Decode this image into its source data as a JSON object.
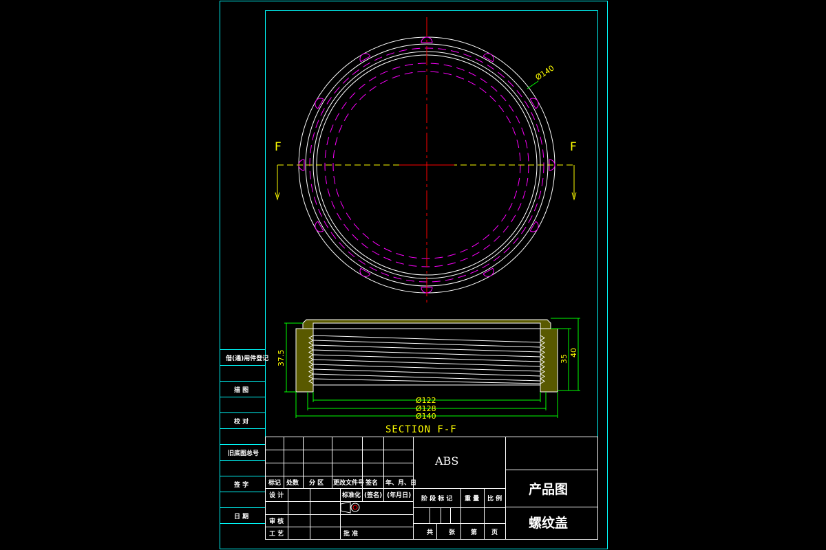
{
  "colors": {
    "frame": "#00ffff",
    "outline": "#ffffff",
    "hidden": "#ff00ff",
    "center": "#ff0000",
    "dimension": "#00ff00",
    "section_line": "#ffff00",
    "hatch": "#ffff00",
    "text_white": "#ffffff",
    "text_yellow": "#ffff00"
  },
  "top_view": {
    "section_marker_left": "F",
    "section_marker_right": "F",
    "dim_diameter": "Ø140"
  },
  "section_view": {
    "title": "SECTION F-F",
    "dim_inner": "Ø122",
    "dim_thread": "Ø128",
    "dim_outer": "Ø140",
    "dim_left_height": "37.5",
    "dim_right_inner_height": "35",
    "dim_right_outer_height": "40"
  },
  "side_column": {
    "items": [
      "借(通)用件登记",
      "描 图",
      "校 对",
      "旧底图总号",
      "签 字",
      "日 期"
    ]
  },
  "title_block": {
    "material": "ABS",
    "drawing_type": "产品图",
    "part_name": "螺纹盖",
    "rev_headers": [
      "标记",
      "处数",
      "分 区",
      "更改文件号",
      "签名",
      "年、月、日"
    ],
    "design_row": [
      "设 计",
      "标准化",
      "(签名)",
      "(年月日)"
    ],
    "review_label": "审 核",
    "process_label": "工 艺",
    "approve_label": "批 准",
    "stage_headers": [
      "阶 段 标 记",
      "重 量",
      "比 例"
    ],
    "sheet_info": [
      "共",
      "张",
      "第",
      "页"
    ]
  }
}
